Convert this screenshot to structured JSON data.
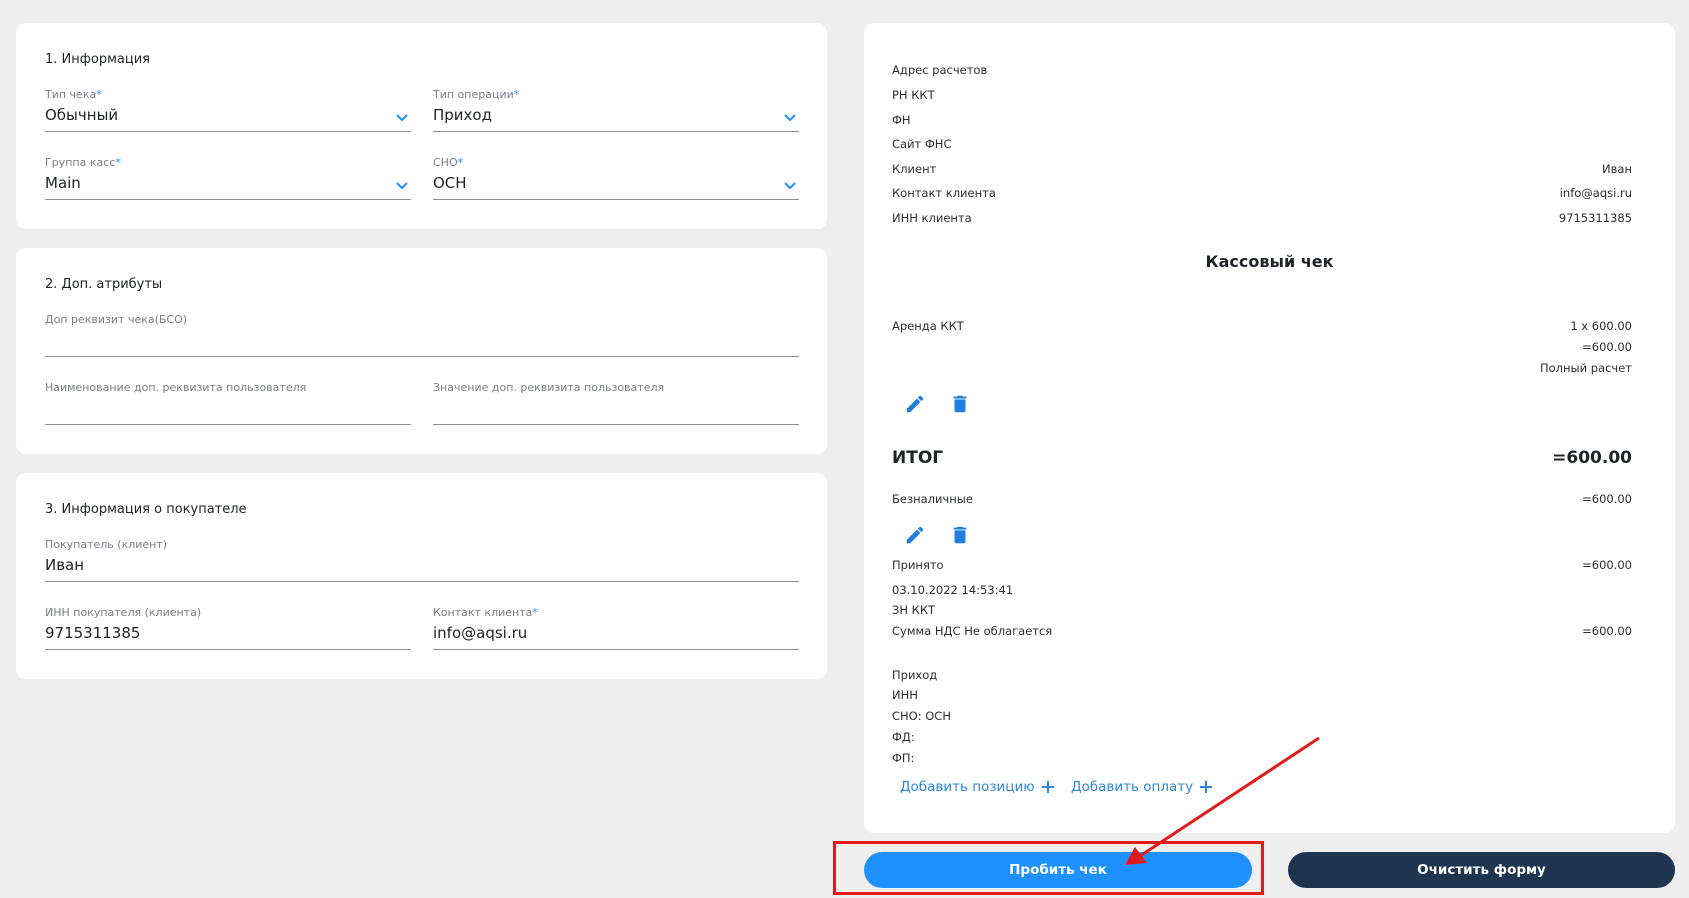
{
  "section1": {
    "title": "1. Информация",
    "receipt_type": {
      "label": "Тип чека",
      "value": "Обычный"
    },
    "operation_type": {
      "label": "Тип операции",
      "value": "Приход"
    },
    "register_group": {
      "label": "Группа касс",
      "value": "Main"
    },
    "tax_system": {
      "label": "СНО",
      "value": "ОСН"
    }
  },
  "section2": {
    "title": "2. Доп. атрибуты",
    "additional_requisite": {
      "label": "Доп реквизит чека(БСО)",
      "value": ""
    },
    "user_requisite_name": {
      "label": "Наименование доп. реквизита пользователя",
      "value": ""
    },
    "user_requisite_value": {
      "label": "Значение доп. реквизита пользователя",
      "value": ""
    }
  },
  "section3": {
    "title": "3. Информация о покупателе",
    "buyer": {
      "label": "Покупатель (клиент)",
      "value": "Иван"
    },
    "buyer_inn": {
      "label": "ИНН покупателя (клиента)",
      "value": "9715311385"
    },
    "client_contact": {
      "label": "Контакт клиента",
      "value": "info@aqsi.ru"
    }
  },
  "receipt": {
    "settlement_address": "Адрес расчетов",
    "rn_kkt": "РН ККТ",
    "fn": "ФН",
    "fns_site": "Сайт ФНС",
    "client_label": "Клиент",
    "client_value": "Иван",
    "contact_label": "Контакт клиента",
    "contact_value": "info@aqsi.ru",
    "inn_label": "ИНН клиента",
    "inn_value": "9715311385",
    "title": "Кассовый чек",
    "item_name": "Аренда ККТ",
    "item_qty": "1 x 600.00",
    "item_sum": "=600.00",
    "item_method": "Полный расчет",
    "total_label": "ИТОГ",
    "total_value": "=600.00",
    "payment_label": "Безналичные",
    "payment_value": "=600.00",
    "accepted_label": "Принято",
    "accepted_value": "=600.00",
    "datetime": "03.10.2022 14:53:41",
    "zn_kkt": "ЗН ККТ",
    "vat_label": "Сумма НДС Не облагается",
    "vat_value": "=600.00",
    "operation": "Приход",
    "inn": "ИНН",
    "sno": "СНО: ОСН",
    "fd": "ФД:",
    "fp": "ФП:",
    "add_position": "Добавить позицию",
    "add_payment": "Добавить оплату"
  },
  "actions": {
    "print_receipt": "Пробить чек",
    "clear_form": "Очистить форму"
  },
  "colors": {
    "accent": "#1e90ff",
    "dark_button": "#1e3550",
    "highlight": "#e01b1b"
  }
}
